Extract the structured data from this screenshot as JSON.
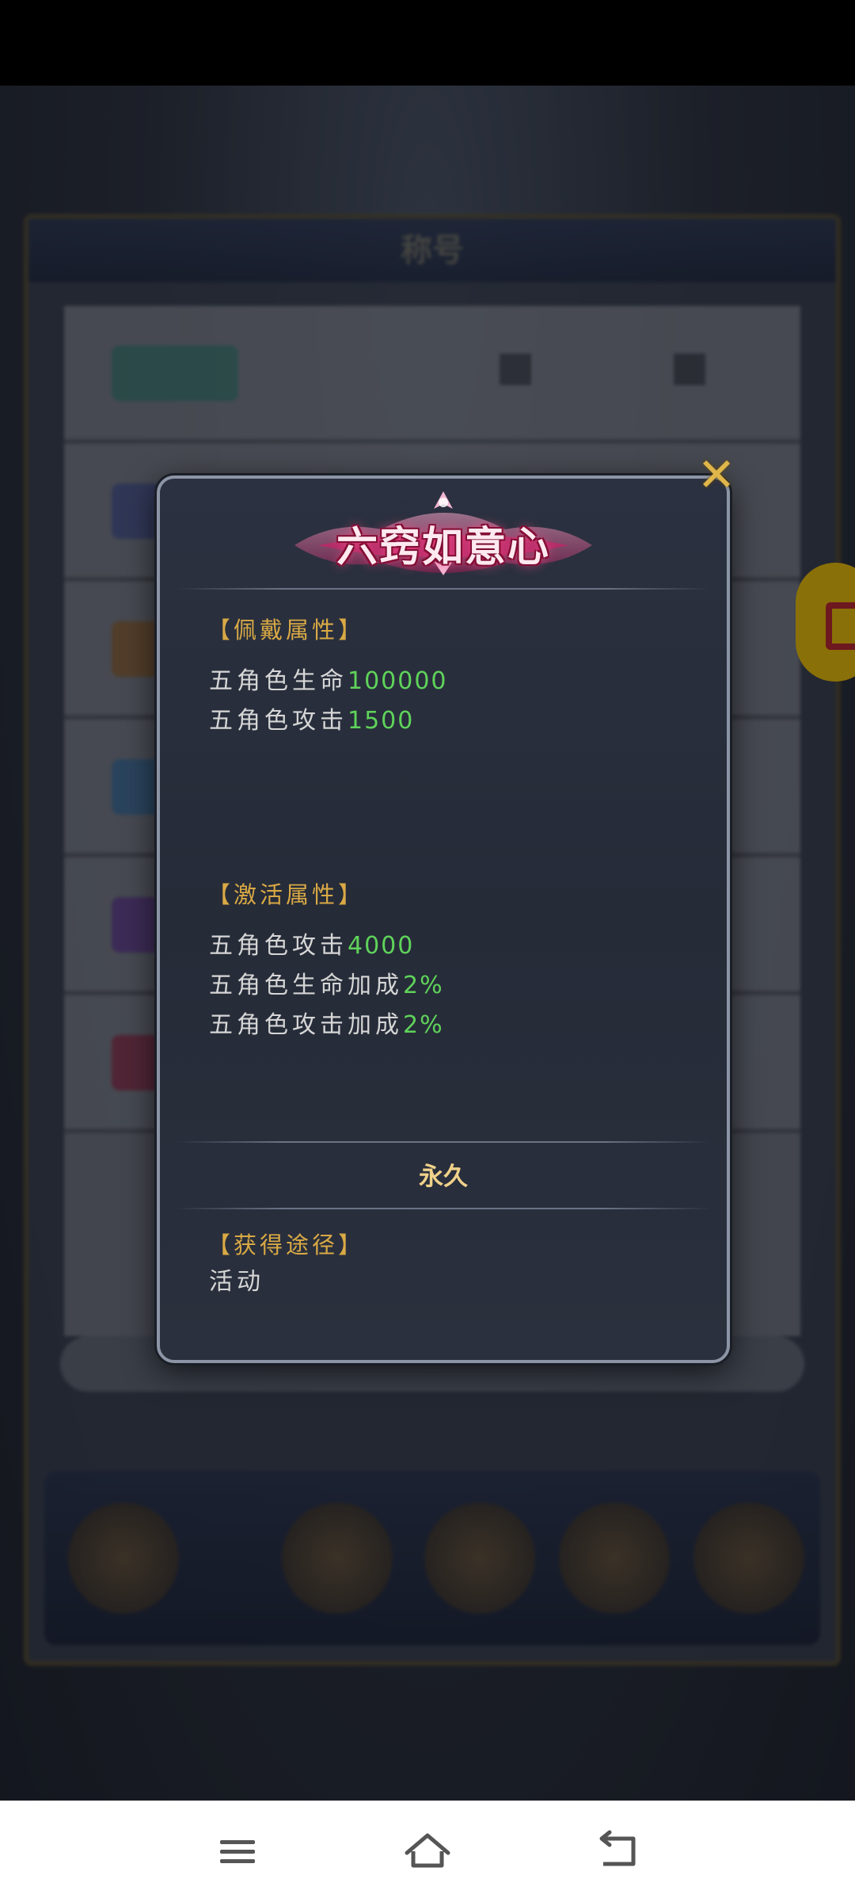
{
  "background": {
    "panel_title": "称号"
  },
  "popup": {
    "title": "六窍如意心",
    "close_symbol": "✕",
    "wear_section": {
      "heading": "【佩戴属性】",
      "lines": [
        {
          "label": "五角色生命",
          "value": "100000"
        },
        {
          "label": "五角色攻击",
          "value": "1500"
        }
      ]
    },
    "activate_section": {
      "heading": "【激活属性】",
      "lines": [
        {
          "label": "五角色攻击",
          "value": "4000"
        },
        {
          "label": "五角色生命加成",
          "value": "2%"
        },
        {
          "label": "五角色攻击加成",
          "value": "2%"
        }
      ]
    },
    "duration": "永久",
    "source_section": {
      "heading": "【获得途径】",
      "text": "活动"
    }
  },
  "nav_bar": {
    "icons": [
      "menu-icon",
      "home-icon",
      "back-icon"
    ]
  },
  "colors": {
    "heading_gold": "#d9a945",
    "value_green": "#5fd35a",
    "duration_gold": "#f0d18a",
    "title_pink": "#ff4a8a"
  }
}
